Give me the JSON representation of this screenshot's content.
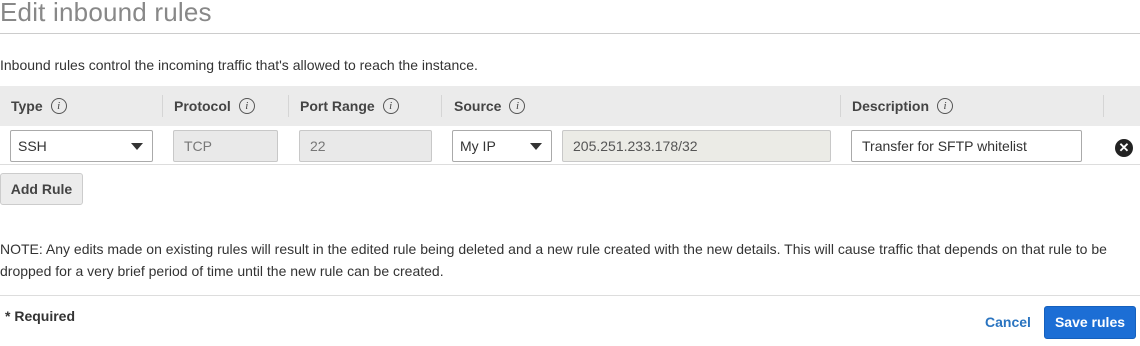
{
  "page": {
    "title": "Edit inbound rules",
    "intro": "Inbound rules control the incoming traffic that's allowed to reach the instance."
  },
  "table": {
    "headers": {
      "type": "Type",
      "protocol": "Protocol",
      "port_range": "Port Range",
      "source": "Source",
      "description": "Description"
    },
    "info_glyph": "i",
    "rows": [
      {
        "type": "SSH",
        "protocol": "TCP",
        "port_range": "22",
        "source_type": "My IP",
        "source_value": "205.251.233.178/32",
        "description": "Transfer for SFTP whitelist"
      }
    ]
  },
  "actions": {
    "add_rule": "Add Rule",
    "remove_glyph": "✕",
    "cancel": "Cancel",
    "save": "Save rules"
  },
  "note": "NOTE: Any edits made on existing rules will result in the edited rule being deleted and a new rule created with the new details. This will cause traffic that depends on that rule to be dropped for a very brief period of time until the new rule can be created.",
  "footer": {
    "required": "* Required"
  },
  "colors": {
    "primary_button": "#1c6ed5",
    "link": "#2a74c0",
    "header_bg": "#ebebeb"
  }
}
